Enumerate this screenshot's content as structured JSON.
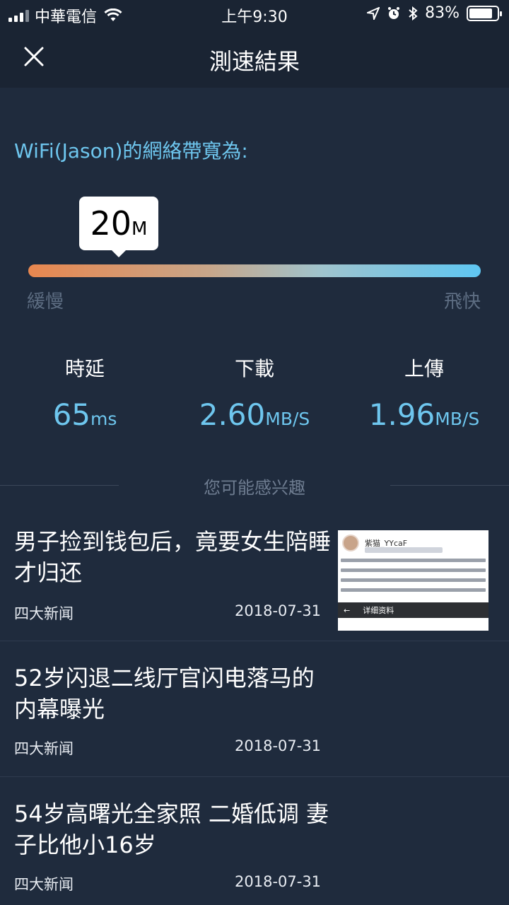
{
  "status": {
    "carrier": "中華電信",
    "time": "上午9:30",
    "battery": "83%",
    "battery_level": 0.83
  },
  "nav": {
    "title": "測速結果"
  },
  "result": {
    "bandwidth_label": "WiFi(Jason)的網絡帶寬為:",
    "bandwidth_value": "20",
    "bandwidth_unit": "M",
    "scale_slow": "緩慢",
    "scale_fast": "飛快"
  },
  "metrics": {
    "latency": {
      "label": "時延",
      "value": "65",
      "unit": "ms"
    },
    "download": {
      "label": "下載",
      "value": "2.60",
      "unit": "MB/S"
    },
    "upload": {
      "label": "上傳",
      "value": "1.96",
      "unit": "MB/S"
    }
  },
  "recommend": {
    "title": "您可能感兴趣",
    "items": [
      {
        "title": "男子捡到钱包后，竟要女生陪睡才归还",
        "source": "四大新闻",
        "date": "2018-07-31",
        "thumb_name": "紫猫_YYcaF",
        "thumb_bar": "详细资料"
      },
      {
        "title": "52岁闪退二线厅官闪电落马的内幕曝光",
        "source": "四大新闻",
        "date": "2018-07-31"
      },
      {
        "title": "54岁高曙光全家照 二婚低调 妻子比他小16岁",
        "source": "四大新闻",
        "date": "2018-07-31"
      }
    ]
  },
  "colors": {
    "background": "#1f2b3d",
    "accent": "#6ec6ee",
    "bar_start": "#e8874f",
    "bar_end": "#5ec6f2"
  }
}
